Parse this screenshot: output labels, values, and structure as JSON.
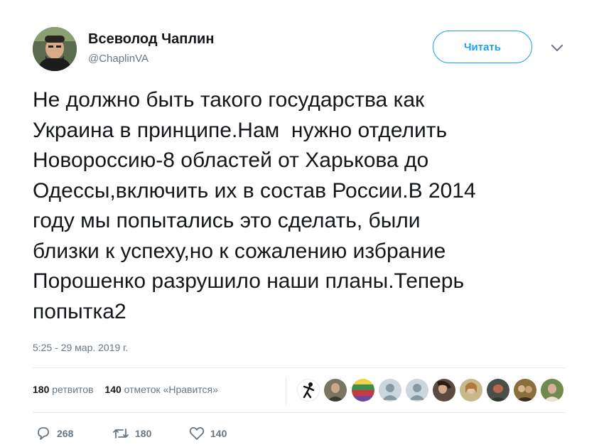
{
  "author": {
    "name": "Всеволод Чаплин",
    "handle": "@ChaplinVA",
    "avatar_icon": "profile-photo"
  },
  "follow_button": {
    "label": "Читать",
    "color": "#1da1f2"
  },
  "menu_icon": "chevron-down-icon",
  "tweet": {
    "lines": [
      "Не должно быть такого государства как",
      "Украина в принципе.Нам  нужно отделить",
      "Новороссию-8 областей от Харькова до",
      "Одессы,включить их в состав России.В 2014",
      "году мы попытались это сделать, были",
      "близки к успеху,но к сожалению избрание",
      "Порошенко разрушило наши планы.Теперь",
      "попытка2"
    ]
  },
  "timestamp": "5:25 - 29 мар. 2019 г.",
  "stats": {
    "retweets_count": "180",
    "retweets_label": "ретвитов",
    "likes_count": "140",
    "likes_label": "отметок «Нравится»"
  },
  "liked_by_avatars": [
    {
      "icon": "silhouette-avatar",
      "color": "#ffffff"
    },
    {
      "icon": "photo-avatar",
      "color": "#7a7560"
    },
    {
      "icon": "flag-avatar",
      "color": "#d9a441"
    },
    {
      "icon": "default-avatar",
      "color": "#ccd6dd"
    },
    {
      "icon": "default-avatar",
      "color": "#ccd6dd"
    },
    {
      "icon": "photo-avatar",
      "color": "#5a4a42"
    },
    {
      "icon": "photo-avatar",
      "color": "#c9b88a"
    },
    {
      "icon": "photo-avatar",
      "color": "#4b4f4a"
    },
    {
      "icon": "photo-avatar",
      "color": "#8a6f3c"
    },
    {
      "icon": "photo-avatar",
      "color": "#6f8a4e"
    }
  ],
  "actions": {
    "reply_count": "268",
    "retweet_count": "180",
    "like_count": "140"
  }
}
